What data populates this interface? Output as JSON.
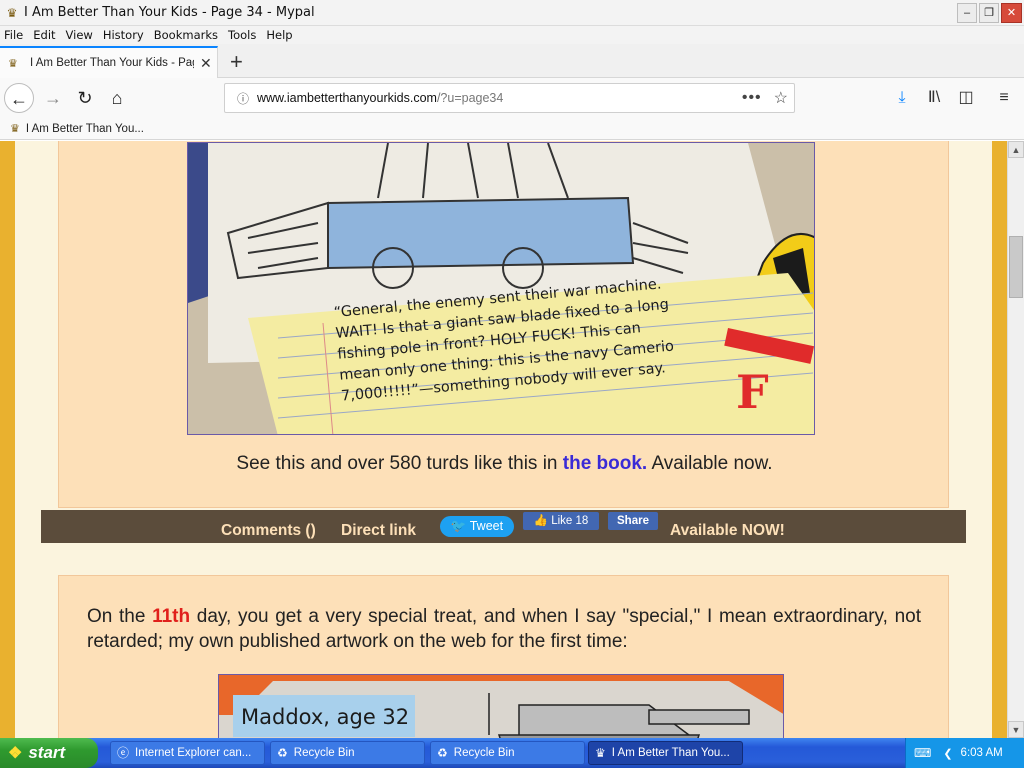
{
  "window": {
    "title": "I Am Better Than Your Kids - Page 34 - Mypal",
    "minimize": "–",
    "restore": "❐",
    "close": "✕"
  },
  "menu": [
    "File",
    "Edit",
    "View",
    "History",
    "Bookmarks",
    "Tools",
    "Help"
  ],
  "tab": {
    "label": "I Am Better Than Your Kids - Page 34 - Mypal",
    "close": "✕",
    "new_tab": "+"
  },
  "nav": {
    "back": "←",
    "forward": "→",
    "reload": "↻",
    "home": "⌂",
    "url_domain": "www.iambetterthanyourkids.com",
    "url_path": "/?u=page34",
    "page_actions": "•••",
    "bookmark_star": "☆",
    "downloads": "⤓",
    "library": "Ⅱ\\",
    "sidebar": "◫",
    "menu": "≡"
  },
  "bookmarks": [
    {
      "label": "I Am Better Than You..."
    }
  ],
  "content": {
    "caption_pre": "See this and over 580 turds like this in ",
    "caption_link": "the book.",
    "caption_post": " Available now.",
    "share": {
      "comments": "Comments ()",
      "direct_link": "Direct link",
      "tweet": "Tweet",
      "like": "Like 18",
      "share": "Share",
      "available": "Available NOW!"
    },
    "comic1_text": [
      "“General, the enemy sent their war machine.",
      "WAIT! Is that a giant saw blade fixed to a long",
      "fishing pole in front? HOLY FUCK! This can",
      "mean only one thing: this is the navy Camerio",
      "7,000!!!!!”—something nobody will ever say."
    ],
    "comic1_grade": "F",
    "para_pre": "On the ",
    "para_num": "11th",
    "para_post": " day, you get a very special treat, and when I say \"special,\" I mean extraordinary, not retarded; my own published artwork on the web for the first time:",
    "comic2_label": "Maddox, age 32"
  },
  "taskbar": {
    "start": "start",
    "tasks": [
      {
        "label": "Internet Explorer can..."
      },
      {
        "label": "Recycle Bin"
      },
      {
        "label": "Recycle Bin"
      },
      {
        "label": "I Am Better Than You..."
      }
    ],
    "clock": "6:03 AM"
  },
  "colors": {
    "accent_tab": "#0a84ff",
    "page_bg": "#e9b12f",
    "card_bg": "#fde0b8",
    "link": "#3a2bd6",
    "highlight": "#e0201b",
    "share_bar": "#5b4c3b"
  }
}
